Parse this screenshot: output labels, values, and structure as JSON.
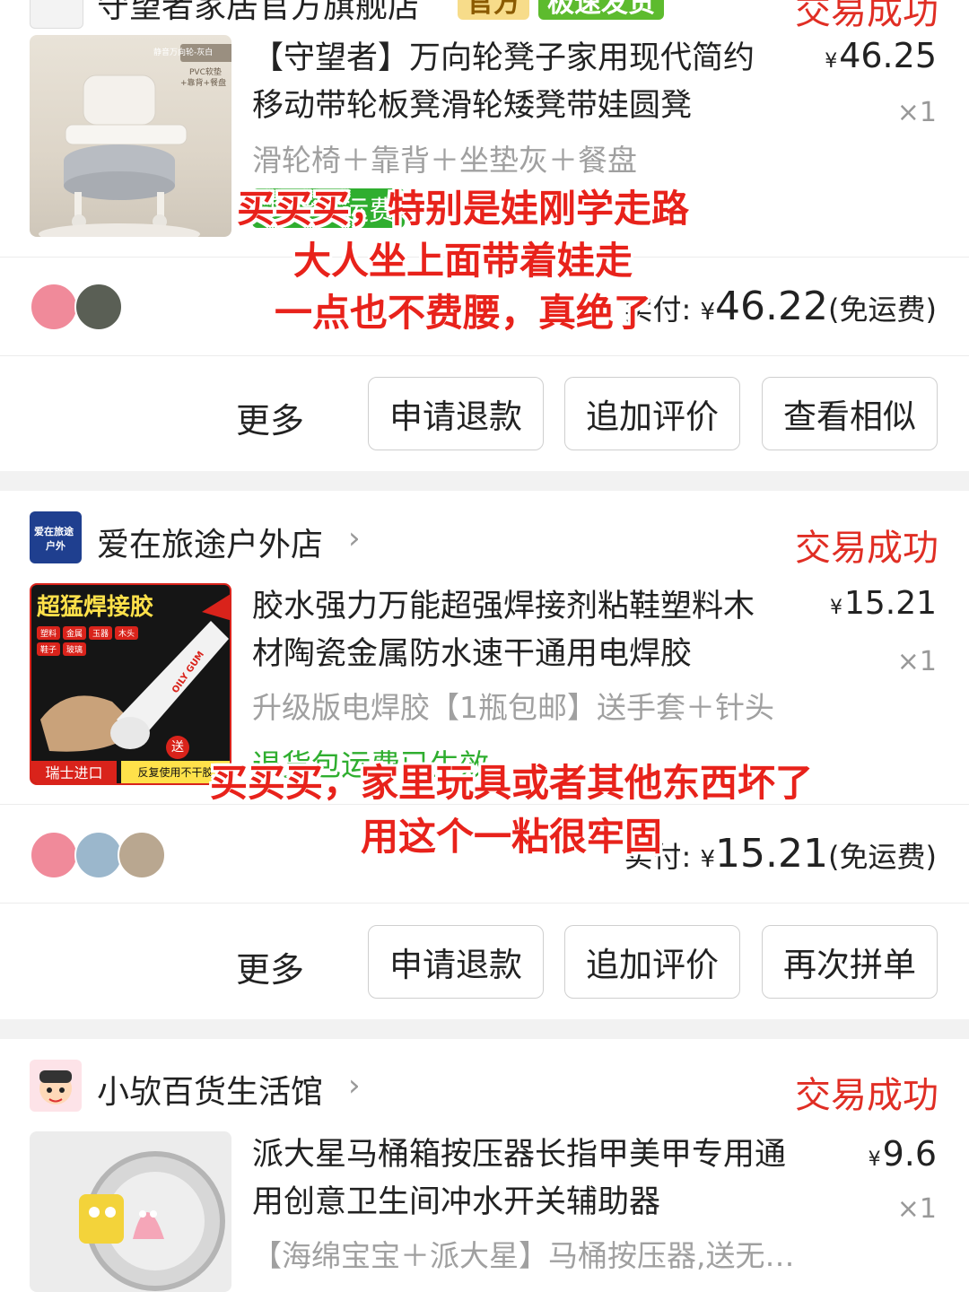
{
  "colors": {
    "accent_red": "#e02e24",
    "overlay_red": "#e8221b",
    "muted": "#a0a0a0",
    "green_tag": "#2fae2f"
  },
  "orders": [
    {
      "shop": {
        "name": "守望者家居官方旗舰店",
        "badge_official": "官方",
        "badge_quick": "极速发货"
      },
      "status": "交易成功",
      "product": {
        "title_line1": "【守望者】万向轮凳子家用现代简约",
        "title_line2": "移动带轮板凳滑轮矮凳带娃圆凳",
        "price": "46.25",
        "qty": "×1",
        "spec": "滑轮椅＋靠背＋坐垫灰＋餐盘",
        "tag": "退货补运费",
        "thumb_text1": "静音万向轮-灰白",
        "thumb_text2": "PVC软垫",
        "thumb_text3": "+靠背+餐盘"
      },
      "paid_label": "实付:",
      "paid_currency": "¥",
      "paid_amount": "46.22",
      "shipping_note": "(免运费)",
      "buttons": {
        "more": "更多",
        "b1": "申请退款",
        "b2": "追加评价",
        "b3": "查看相似"
      },
      "overlay": {
        "line1": "买买买，特别是娃刚学走路",
        "line2": "大人坐上面带着娃走",
        "line3": "一点也不费腰，真绝了"
      }
    },
    {
      "shop": {
        "name": "爱在旅途户外店",
        "icon_text1": "爱在旅途",
        "icon_text2": "户外"
      },
      "status": "交易成功",
      "product": {
        "title_line1": "胶水强力万能超强焊接剂粘鞋塑料木",
        "title_line2": "材陶瓷金属防水速干通用电焊胶",
        "price": "15.21",
        "qty": "×1",
        "spec": "升级版电焊胶【1瓶包邮】送手套＋针头",
        "tag": "退货包运费已生效",
        "thumb_title": "超猛焊接胶",
        "thumb_tags": [
          "塑料",
          "金属",
          "玉器",
          "木头",
          "鞋子",
          "玻璃"
        ],
        "thumb_bottom_left": "瑞士进口",
        "thumb_bottom_right": "反复使用不干胶",
        "thumb_send": "送",
        "thumb_brand": "OILY GUM"
      },
      "paid_label": "实付:",
      "paid_currency": "¥",
      "paid_amount": "15.21",
      "shipping_note": "(免运费)",
      "buttons": {
        "more": "更多",
        "b1": "申请退款",
        "b2": "追加评价",
        "b3": "再次拼单"
      },
      "overlay": {
        "line1": "买买买，家里玩具或者其他东西坏了",
        "line2": "用这个一粘很牢固"
      }
    },
    {
      "shop": {
        "name": "小欤百货生活馆"
      },
      "status": "交易成功",
      "product": {
        "title_line1": "派大星马桶箱按压器长指甲美甲专用通",
        "title_line2": "用创意卫生间冲水开关辅助器",
        "price": "9.6",
        "qty": "×1",
        "spec": "【海绵宝宝＋派大星】马桶按压器,送无…"
      }
    }
  ]
}
